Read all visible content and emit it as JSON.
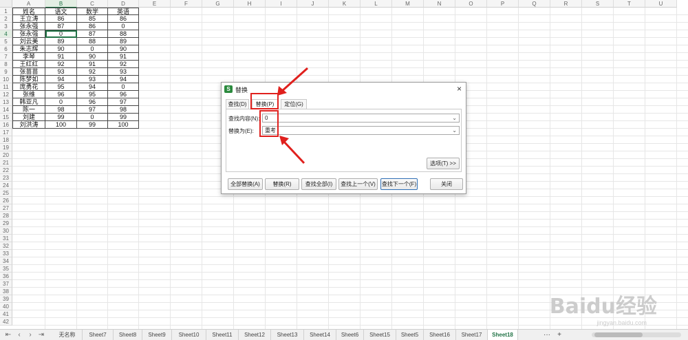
{
  "columns": [
    "A",
    "B",
    "C",
    "D",
    "E",
    "F",
    "G",
    "H",
    "I",
    "J",
    "K",
    "L",
    "M",
    "N",
    "O",
    "P",
    "Q",
    "R",
    "S",
    "T",
    "U"
  ],
  "rows": [
    "1",
    "2",
    "3",
    "4",
    "5",
    "6",
    "7",
    "8",
    "9",
    "10",
    "11",
    "12",
    "13",
    "14",
    "15",
    "16",
    "17",
    "18",
    "19",
    "20",
    "21",
    "22",
    "23",
    "24",
    "25",
    "26",
    "27",
    "28",
    "29",
    "30",
    "31",
    "32",
    "33",
    "34",
    "35",
    "36",
    "37",
    "38",
    "39",
    "40",
    "41",
    "42"
  ],
  "table": [
    [
      "姓名",
      "语文",
      "数学",
      "英语"
    ],
    [
      "王立涛",
      "86",
      "85",
      "86"
    ],
    [
      "张永强",
      "87",
      "86",
      "0"
    ],
    [
      "张永强",
      "0",
      "87",
      "88"
    ],
    [
      "刘云美",
      "89",
      "88",
      "89"
    ],
    [
      "朱志辉",
      "90",
      "0",
      "90"
    ],
    [
      "李琴",
      "91",
      "90",
      "91"
    ],
    [
      "王红红",
      "92",
      "91",
      "92"
    ],
    [
      "张苗苗",
      "93",
      "92",
      "93"
    ],
    [
      "陈梦如",
      "94",
      "93",
      "94"
    ],
    [
      "庞勇花",
      "95",
      "94",
      "0"
    ],
    [
      "张维",
      "96",
      "95",
      "96"
    ],
    [
      "韩亚凡",
      "0",
      "96",
      "97"
    ],
    [
      "陈一",
      "98",
      "97",
      "98"
    ],
    [
      "刘建",
      "99",
      "0",
      "99"
    ],
    [
      "刘洪涛",
      "100",
      "99",
      "100"
    ]
  ],
  "dialog": {
    "title": "替换",
    "icon": "S",
    "close": "×",
    "tabs": [
      "查找(D)",
      "替换(P)",
      "定位(G)"
    ],
    "find_label": "查找内容(N):",
    "find_value": "0",
    "replace_label": "替换为(E):",
    "replace_value": "重考",
    "options": "选项(T) >>",
    "buttons": [
      "全部替换(A)",
      "替换(R)",
      "查找全部(I)",
      "查找上一个(V)",
      "查找下一个(F)",
      "关闭"
    ]
  },
  "sheet_tabs": [
    "无名称",
    "Sheet7",
    "Sheet8",
    "Sheet9",
    "Sheet10",
    "Sheet11",
    "Sheet12",
    "Sheet13",
    "Sheet14",
    "Sheet6",
    "Sheet15",
    "Sheet5",
    "Sheet16",
    "Sheet17",
    "Sheet18"
  ],
  "active_sheet": "Sheet18",
  "tab_plus": "+",
  "tab_more": "···",
  "watermark": "Baidu经验",
  "watermark_url": "jingyan.baidu.com",
  "colors": {
    "accent": "#217346",
    "highlight": "#e0201d"
  }
}
